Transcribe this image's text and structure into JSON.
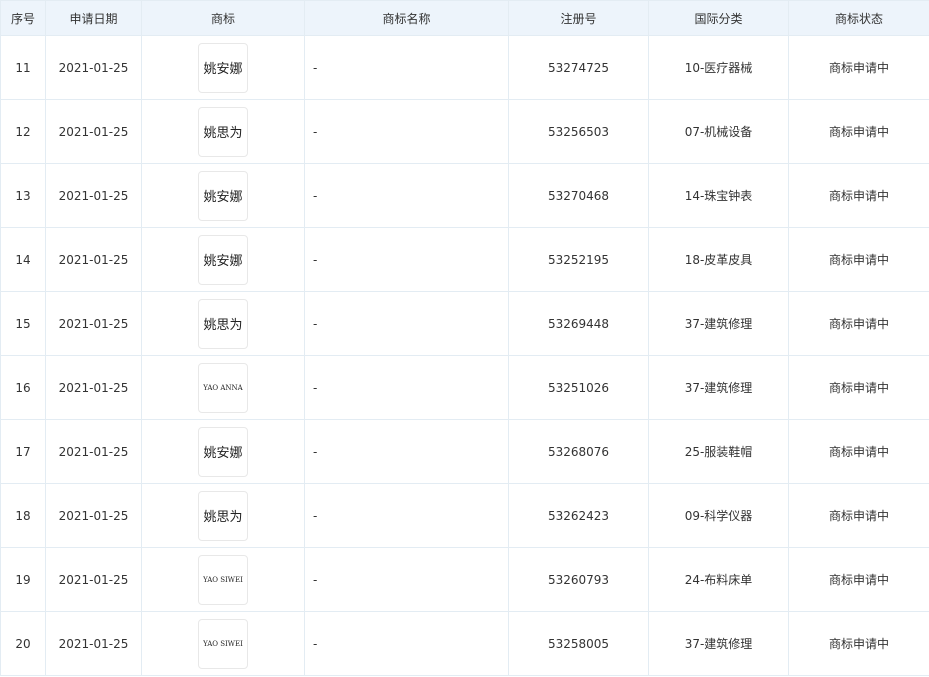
{
  "table": {
    "headers": [
      "序号",
      "申请日期",
      "商标",
      "商标名称",
      "注册号",
      "国际分类",
      "商标状态"
    ],
    "rows": [
      {
        "index": "11",
        "date": "2021-01-25",
        "logo_text": "姚安娜",
        "name": "-",
        "reg_no": "53274725",
        "class": "10-医疗器械",
        "status": "商标申请中"
      },
      {
        "index": "12",
        "date": "2021-01-25",
        "logo_text": "姚思为",
        "name": "-",
        "reg_no": "53256503",
        "class": "07-机械设备",
        "status": "商标申请中"
      },
      {
        "index": "13",
        "date": "2021-01-25",
        "logo_text": "姚安娜",
        "name": "-",
        "reg_no": "53270468",
        "class": "14-珠宝钟表",
        "status": "商标申请中"
      },
      {
        "index": "14",
        "date": "2021-01-25",
        "logo_text": "姚安娜",
        "name": "-",
        "reg_no": "53252195",
        "class": "18-皮革皮具",
        "status": "商标申请中"
      },
      {
        "index": "15",
        "date": "2021-01-25",
        "logo_text": "姚思为",
        "name": "-",
        "reg_no": "53269448",
        "class": "37-建筑修理",
        "status": "商标申请中"
      },
      {
        "index": "16",
        "date": "2021-01-25",
        "logo_text": "YAO ANNA",
        "name": "-",
        "reg_no": "53251026",
        "class": "37-建筑修理",
        "status": "商标申请中"
      },
      {
        "index": "17",
        "date": "2021-01-25",
        "logo_text": "姚安娜",
        "name": "-",
        "reg_no": "53268076",
        "class": "25-服装鞋帽",
        "status": "商标申请中"
      },
      {
        "index": "18",
        "date": "2021-01-25",
        "logo_text": "姚思为",
        "name": "-",
        "reg_no": "53262423",
        "class": "09-科学仪器",
        "status": "商标申请中"
      },
      {
        "index": "19",
        "date": "2021-01-25",
        "logo_text": "YAO SIWEI",
        "name": "-",
        "reg_no": "53260793",
        "class": "24-布料床单",
        "status": "商标申请中"
      },
      {
        "index": "20",
        "date": "2021-01-25",
        "logo_text": "YAO SIWEI",
        "name": "-",
        "reg_no": "53258005",
        "class": "37-建筑修理",
        "status": "商标申请中"
      }
    ]
  },
  "colors": {
    "header_bg": "#edf4fb",
    "border": "#e3ecf3",
    "text": "#333333"
  }
}
